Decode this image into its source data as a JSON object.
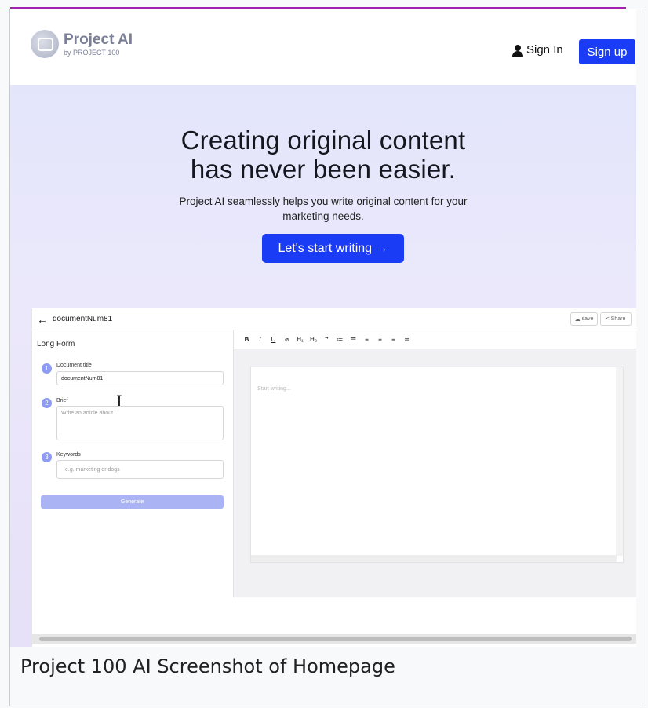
{
  "header": {
    "logo_name": "Project AI",
    "logo_sub": "by PROJECT 100",
    "signin_label": "Sign In",
    "signup_label": "Sign up"
  },
  "hero": {
    "headline_line1": "Creating original content",
    "headline_line2": "has never been easier.",
    "lead": "Project AI seamlessly helps you write original content for your marketing needs.",
    "cta_label": "Let's start writing →"
  },
  "app": {
    "doc_name": "documentNum81",
    "back_glyph": "←",
    "save_label": "save",
    "share_label": "Share",
    "panel_title": "Long Form",
    "steps": [
      {
        "num": "1",
        "label": "Document title",
        "value": "documentNum81"
      },
      {
        "num": "2",
        "label": "Brief",
        "placeholder": "Write an article about ..."
      },
      {
        "num": "3",
        "label": "Keywords",
        "placeholder": "e.g. marketing or dogs"
      }
    ],
    "generate_label": "Generate",
    "toolbar": [
      "B",
      "I",
      "U",
      "⌀",
      "H₁",
      "H₂",
      "❞",
      "≔",
      "☰",
      "≡",
      "≡",
      "≡",
      "≣"
    ],
    "editor_placeholder": "Start writing..."
  },
  "caption": "Project 100 AI Screenshot of Homepage"
}
